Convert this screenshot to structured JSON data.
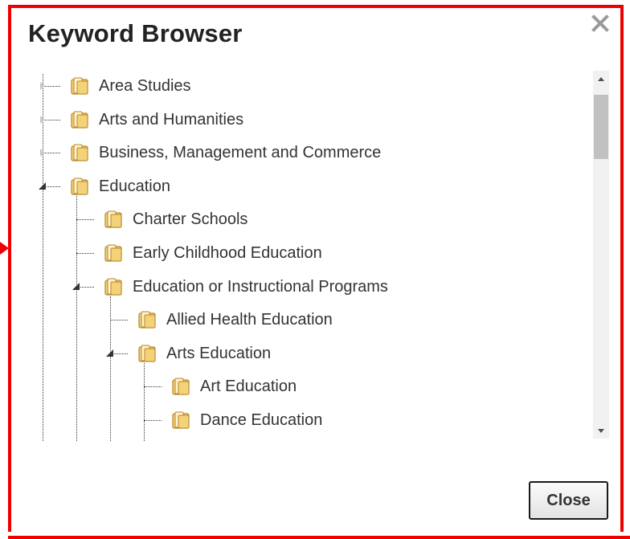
{
  "dialog": {
    "title": "Keyword Browser",
    "close_button_label": "Close"
  },
  "tree": {
    "nodes": [
      {
        "label": "Area Studies",
        "depth": 0,
        "state": "collapsed"
      },
      {
        "label": "Arts and Humanities",
        "depth": 0,
        "state": "collapsed"
      },
      {
        "label": "Business, Management and Commerce",
        "depth": 0,
        "state": "collapsed"
      },
      {
        "label": "Education",
        "depth": 0,
        "state": "expanded"
      },
      {
        "label": "Charter Schools",
        "depth": 1,
        "state": "leaf"
      },
      {
        "label": "Early Childhood Education",
        "depth": 1,
        "state": "leaf"
      },
      {
        "label": "Education or Instructional Programs",
        "depth": 1,
        "state": "expanded"
      },
      {
        "label": "Allied Health Education",
        "depth": 2,
        "state": "leaf"
      },
      {
        "label": "Arts Education",
        "depth": 2,
        "state": "expanded"
      },
      {
        "label": "Art Education",
        "depth": 3,
        "state": "leaf"
      },
      {
        "label": "Dance Education",
        "depth": 3,
        "state": "leaf"
      }
    ]
  },
  "icons": {
    "node": "folder-icon",
    "close": "close-icon",
    "scroll_up": "scroll-up-arrow-icon",
    "scroll_down": "scroll-down-arrow-icon"
  },
  "colors": {
    "frame": "#ee0000",
    "folder_fill": "#f3d27a",
    "folder_stroke": "#b8862b"
  }
}
